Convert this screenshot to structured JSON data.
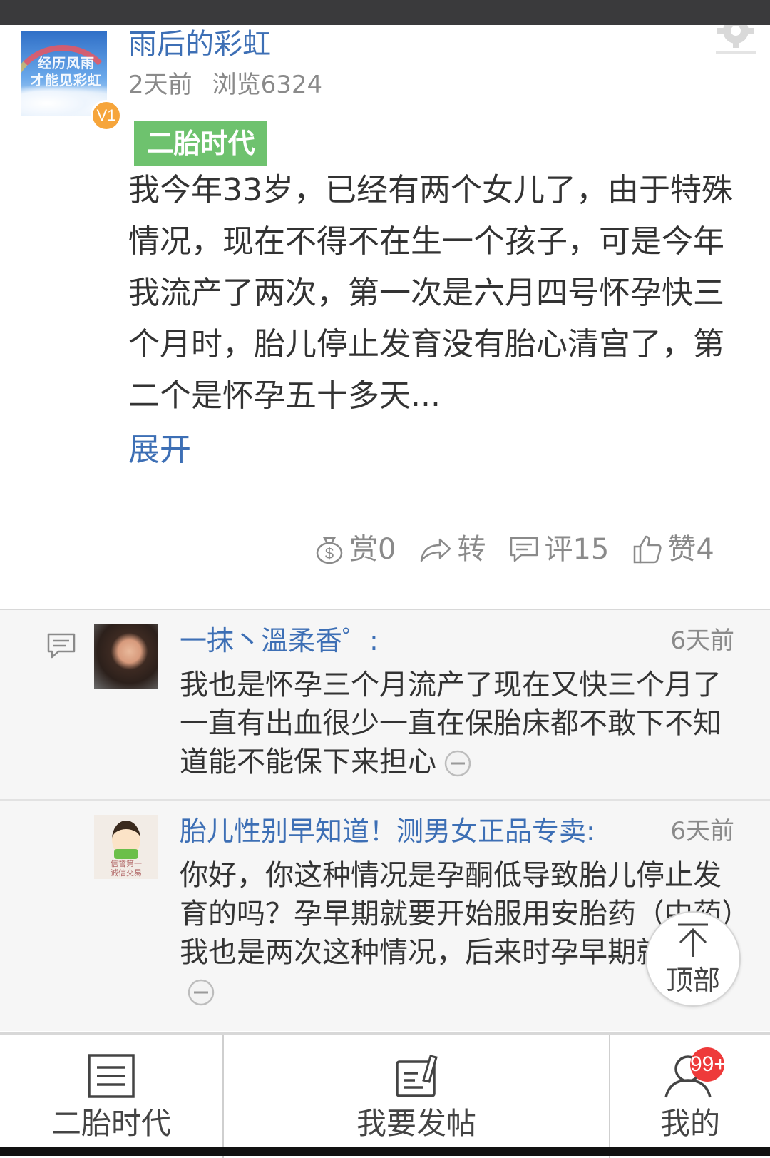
{
  "post": {
    "author": {
      "name": "雨后的彩虹",
      "avatar_text": "经历风雨\n才能见彩虹",
      "level": "V1"
    },
    "time_ago": "2天前",
    "views": "浏览6324",
    "topic_tag": "二胎时代",
    "body": "我今年33岁，已经有两个女儿了，由于特殊情况，现在不得不在生一个孩子，可是今年我流产了两次，第一次是六月四号怀孕快三个月时，胎儿停止发育没有胎心清宫了，第二个是怀孕五十多天...",
    "expand_label": "展开",
    "actions": {
      "reward": "赏0",
      "share": "转",
      "comment": "评15",
      "like": "赞4"
    }
  },
  "comments": [
    {
      "author": "一抹丶溫柔香゜:",
      "time": "6天前",
      "text": "我也是怀孕三个月流产了现在又快三个月了一直有出血很少一直在保胎床都不敢下不知道能不能保下来担心"
    },
    {
      "author": "胎儿性别早知道！测男女正品专卖:",
      "time": "6天前",
      "avatar_text": "信誉第一\n诚信交易",
      "text": "你好，你这种情况是孕酮低导致胎儿停止发育的吗？孕早期就要开始服用安胎药（中药）我也是两次这种情况，后来时孕早期就开..."
    }
  ],
  "back_to_top": "顶部",
  "tabbar": {
    "tab1": "二胎时代",
    "tab2": "我要发帖",
    "tab3": "我的",
    "badge": "99+"
  },
  "colors": {
    "link_blue": "#3d6fb5",
    "tag_green": "#6ec26e",
    "badge_red": "#ee3a3a",
    "level_orange": "#f6a53b"
  }
}
